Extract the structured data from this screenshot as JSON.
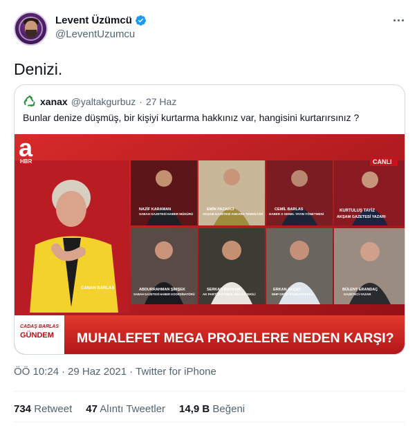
{
  "author": {
    "display_name": "Levent Üzümcü",
    "handle": "@LeventUzumcu",
    "verified": true
  },
  "tweet": {
    "text": "Denizi.",
    "time": "ÖÖ 10:24",
    "date": "29 Haz 2021",
    "source": "Twitter for iPhone",
    "separator": "·"
  },
  "quoted": {
    "display_name": "xanax",
    "handle": "@yaltakgurbuz",
    "separator": "·",
    "date": "27 Haz",
    "text": "Bunlar denize düşmüş, bir kişiyi kurtarma hakkınız var, hangisini kurtarırsınız ?",
    "media": {
      "channel_logo": "a",
      "channel_sub": "HBR",
      "live": "CANLI",
      "show_name_line1": "CADAŞ BARLAS",
      "show_name_line2": "GÜNDEM",
      "headline": "MUHALEFET MEGA PROJELERE NEDEN KARŞI?",
      "guests": [
        {
          "name": "NAZİF KARAMAN",
          "title": "SABAH GAZETESİ HABER MÜDÜRÜ"
        },
        {
          "name": "EMİN PAZARCI",
          "title": "AKŞAM GAZETESİ ANKARA TEMSİLCİSİ"
        },
        {
          "name": "CEMİL BARLAS",
          "title": "HABER X GENEL YAYIN YÖNETMENİ"
        },
        {
          "name": "KURTULUŞ TAYİZ",
          "title": "AKŞAM GAZETESİ YAZARI"
        },
        {
          "name": "CANAN BARLAS",
          "title": ""
        },
        {
          "name": "ABDURRAHMAN ŞİMŞEK",
          "title": "SABAH GAZETESİ HABER KOORDİNATÖRÜ"
        },
        {
          "name": "SERKAN BAYRAM",
          "title": "AK PARTİ İSTANBUL MİLLETVEKİLİ"
        },
        {
          "name": "ERKAN AKÇAY",
          "title": "MHP GRUP BAŞKANVEKİLİ"
        },
        {
          "name": "BÜLENT ERANDAÇ",
          "title": "GAZETECİ-YAZAR"
        }
      ]
    }
  },
  "stats": {
    "retweets_count": "734",
    "retweets_label": "Retweet",
    "quotes_count": "47",
    "quotes_label": "Alıntı Tweetler",
    "likes_count": "14,9 B",
    "likes_label": "Beğeni"
  },
  "colors": {
    "verified": "#1d9bf0",
    "studio_red": "#c11a24",
    "recycle_green": "#2f8f3a"
  },
  "icons": {
    "verified": "verified-badge-icon",
    "more": "more-dots-icon",
    "quote_avatar": "recycle-icon"
  }
}
